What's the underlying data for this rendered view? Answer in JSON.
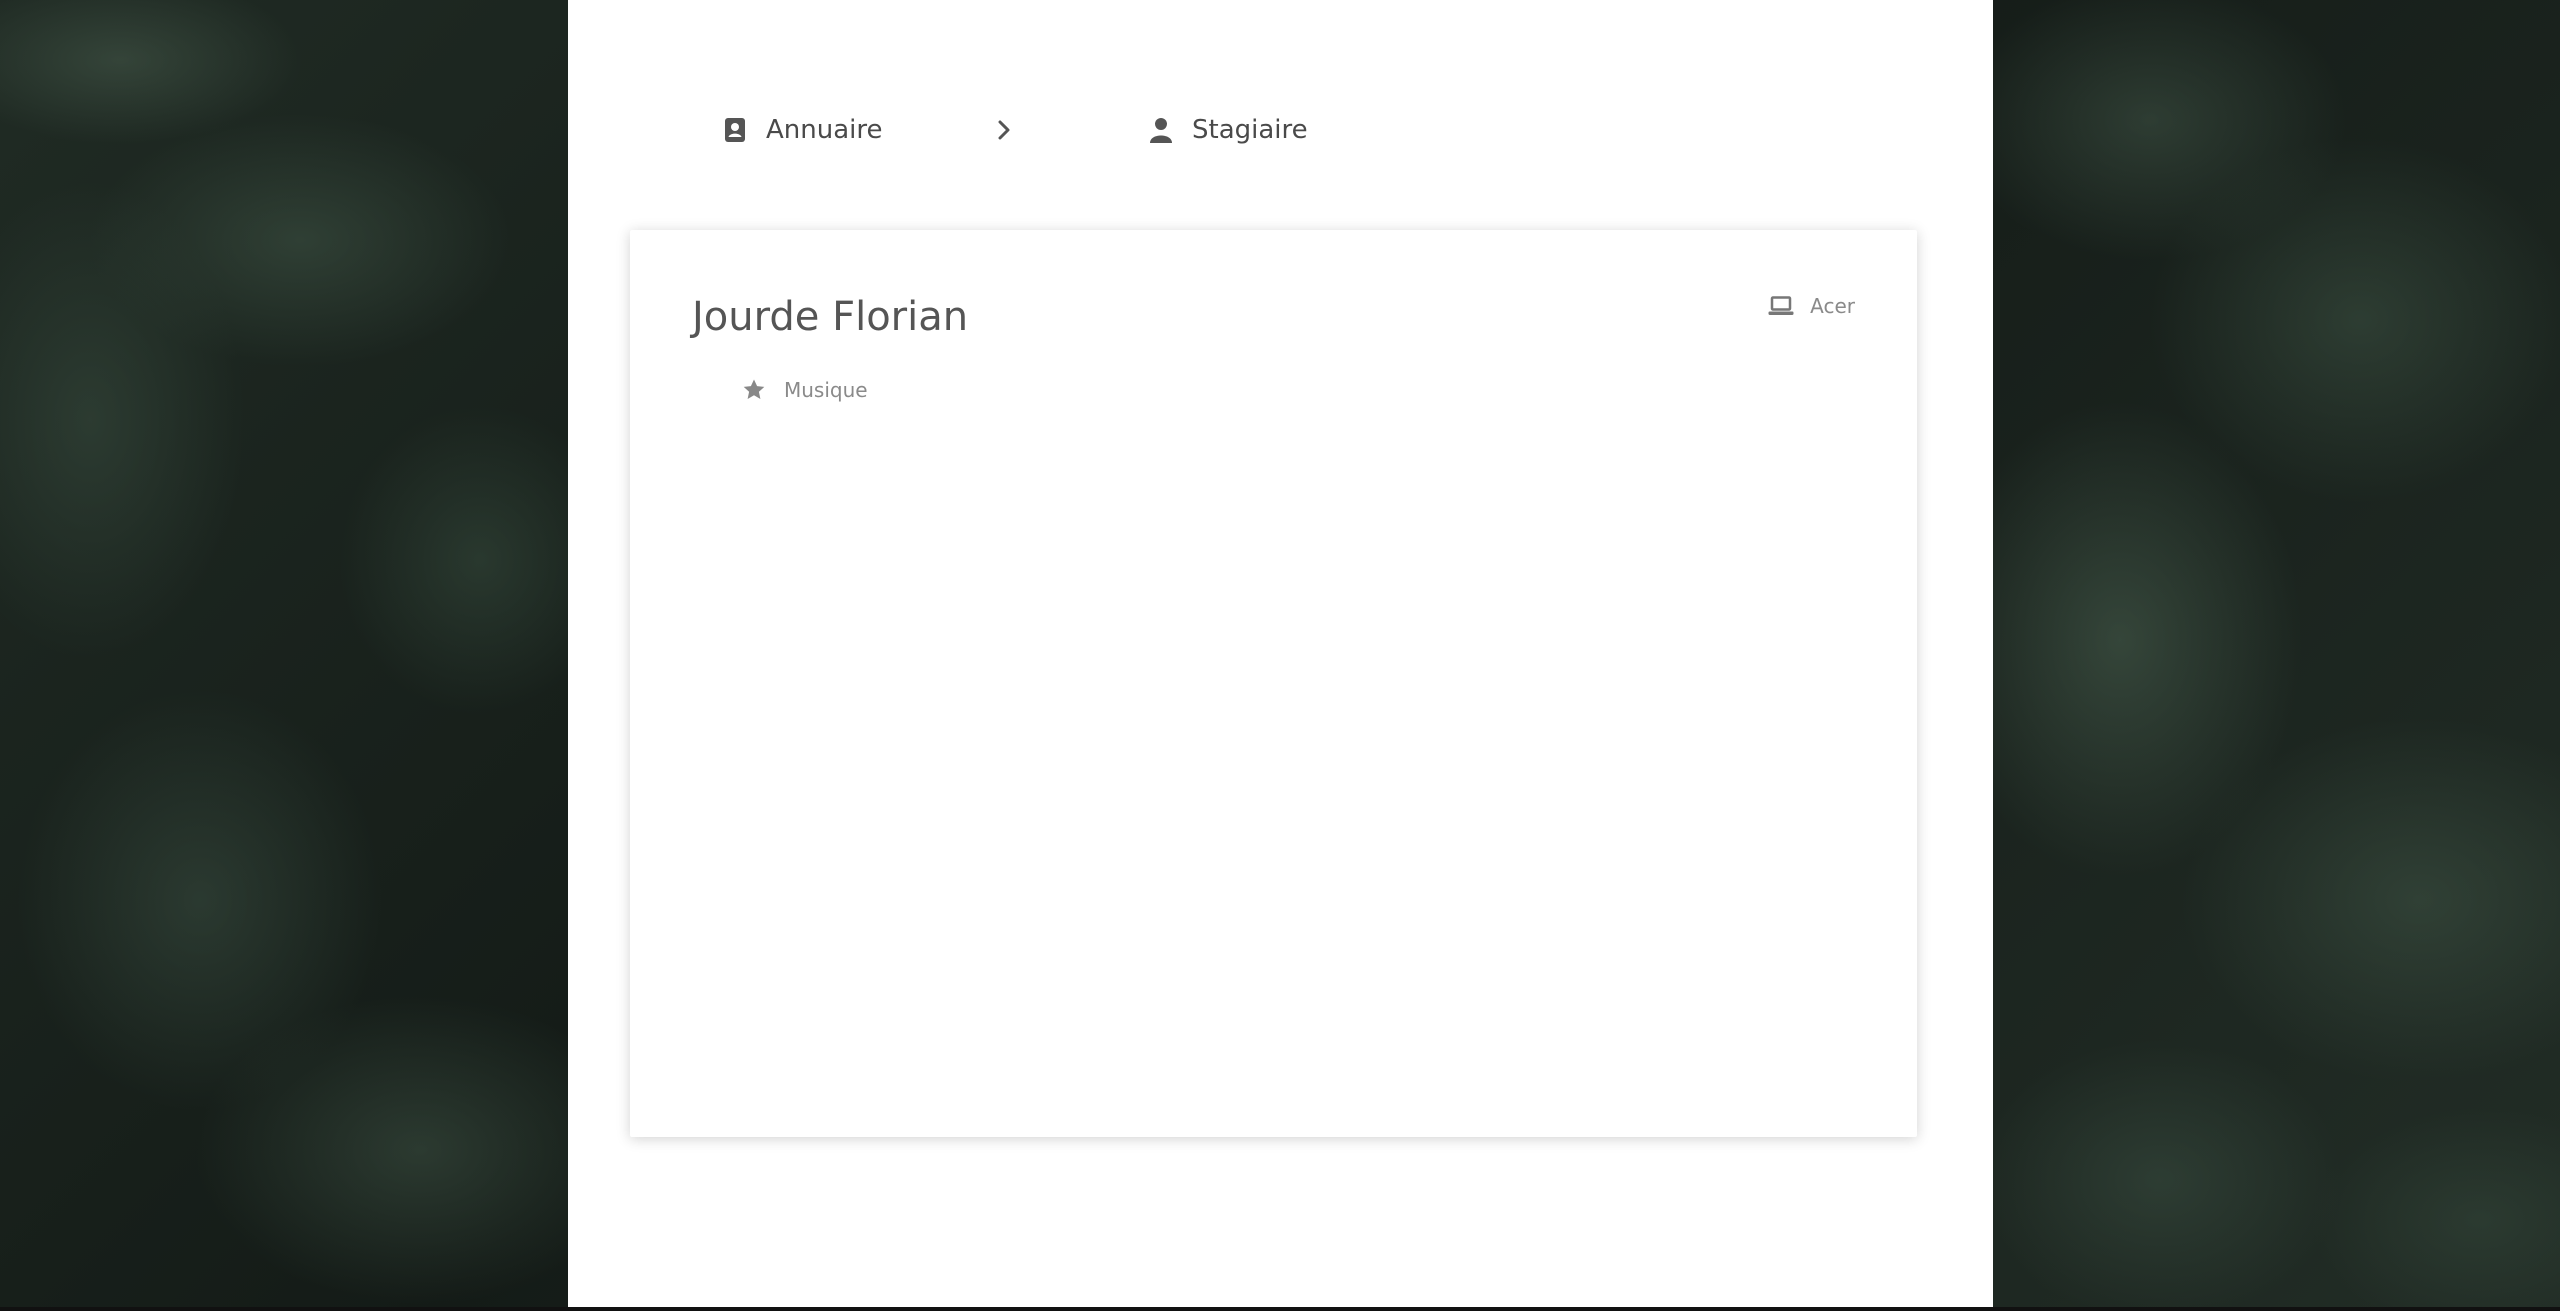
{
  "breadcrumb": {
    "items": [
      {
        "label": "Annuaire",
        "icon": "address-book-icon"
      },
      {
        "label": "Stagiaire",
        "icon": "user-icon"
      }
    ],
    "separator_icon": "chevron-right-icon"
  },
  "card": {
    "name": "Jourde Florian",
    "device": {
      "label": "Acer",
      "icon": "laptop-icon"
    },
    "tags": [
      {
        "label": "Musique",
        "icon": "star-icon"
      }
    ]
  },
  "colors": {
    "text_primary": "#555555",
    "text_secondary": "#8a8a8a",
    "panel_background": "#ffffff"
  }
}
